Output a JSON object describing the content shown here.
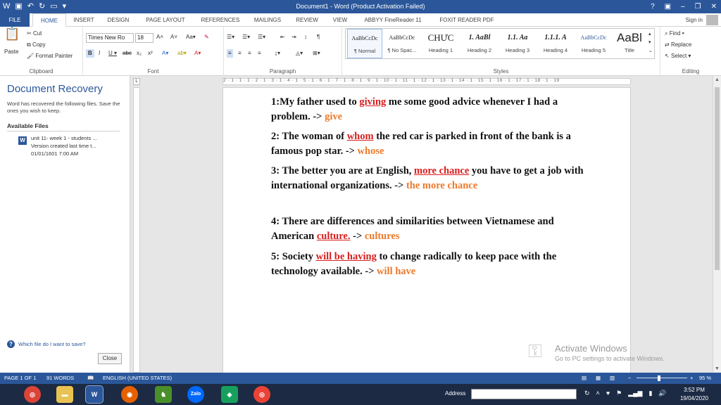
{
  "window": {
    "title": "Document1 - Word (Product Activation Failed)",
    "controls": [
      "?",
      "▣",
      "–",
      "❐",
      "✕"
    ]
  },
  "tabs": [
    "FILE",
    "HOME",
    "INSERT",
    "DESIGN",
    "PAGE LAYOUT",
    "REFERENCES",
    "MAILINGS",
    "REVIEW",
    "VIEW",
    "ABBYY FineReader 11",
    "FOXIT READER PDF"
  ],
  "signin": "Sign in",
  "ribbon": {
    "clipboard": {
      "label": "Clipboard",
      "paste": "Paste",
      "cut": "Cut",
      "copy": "Copy",
      "format_painter": "Format Painter"
    },
    "font": {
      "label": "Font",
      "family": "Times New Ro",
      "size": "18"
    },
    "paragraph": {
      "label": "Paragraph"
    },
    "styles": {
      "label": "Styles",
      "items": [
        {
          "preview": "AaBbCcDc",
          "name": "¶ Normal"
        },
        {
          "preview": "AaBbCcDc",
          "name": "¶ No Spac..."
        },
        {
          "preview": "CHƯC",
          "name": "Heading 1"
        },
        {
          "preview": "1. AaBl",
          "name": "Heading 2"
        },
        {
          "preview": "1.1. Aa",
          "name": "Heading 3"
        },
        {
          "preview": "1.1.1. A",
          "name": "Heading 4"
        },
        {
          "preview": "AaBbCcDc",
          "name": "Heading 5"
        },
        {
          "preview": "AaBl",
          "name": "Title"
        }
      ]
    },
    "editing": {
      "label": "Editing",
      "find": "Find",
      "replace": "Replace",
      "select": "Select"
    }
  },
  "recovery": {
    "title": "Document Recovery",
    "description": "Word has recovered the following files. Save the ones you wish to keep.",
    "available": "Available Files",
    "file": {
      "name": "unit 11- week 1 - students ...",
      "version": "Version created last time t...",
      "date": "01/01/1601 7:00 AM"
    },
    "help": "Which file do I want to save?",
    "close": "Close"
  },
  "ruler": {
    "numbers": "2 · 1 · 1 · 1 · 2 · 1 · 3 · 1 · 4 · 1 · 5 · 1 · 6 · 1 · 7 · 1 · 8 · 1 · 9 · 1 · 10 · 1 · 11 · 1 · 12 · 1 · 13 · 1 · 14 · 1 · 15 · 1 · 16 · 1 · 17 · 1 · 18 · 1 · 19"
  },
  "document": {
    "paragraphs": [
      {
        "before": "1:My father used to ",
        "error": "giving",
        "after": " me some good advice whenever I had a problem. -> ",
        "fix": "give"
      },
      {
        "before": "2: The woman of ",
        "error": "whom",
        "after": " the red car is parked in front of the bank is a famous pop star. -> ",
        "fix": "whose"
      },
      {
        "before": " 3: The better you are at English, ",
        "error": "more chance",
        "after": " you have to get a job with international organizations. -> ",
        "fix": "the more chance"
      },
      {
        "before": " 4: There are differences and similarities between Vietnamese and American ",
        "error": "culture.",
        "after": " -> ",
        "fix": "cultures"
      },
      {
        "before": "5: Society ",
        "error": "will be having",
        "after": " to change radically to keep pace with the technology available. -> ",
        "fix": "will have"
      }
    ]
  },
  "watermark": {
    "line1": "Activate Windows",
    "line2": "Go to PC settings to activate Windows."
  },
  "statusbar": {
    "page": "PAGE 1 OF 1",
    "words": "91 WORDS",
    "language": "ENGLISH (UNITED STATES)",
    "zoom": "95 %",
    "zoom_level": 0.45
  },
  "taskbar": {
    "address_label": "Address",
    "time": "3:52 PM",
    "date": "19/04/2020",
    "zalo": "Zalo"
  },
  "colors": {
    "accent": "#2b579a",
    "error": "#d81e1e",
    "fix": "#ec7a2c"
  }
}
